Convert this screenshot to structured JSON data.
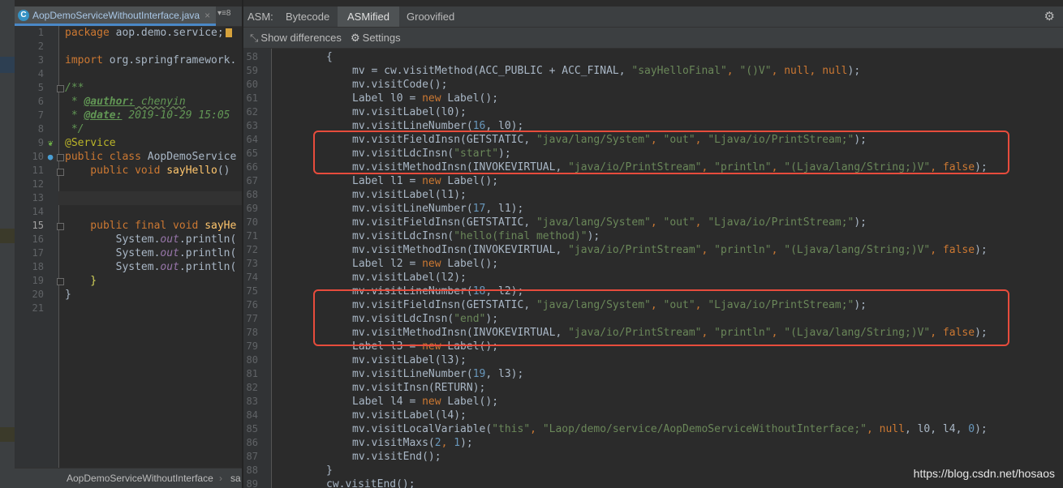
{
  "left_editor": {
    "tab_title": "AopDemoServiceWithoutInterface.java",
    "tab_icon_letter": "C",
    "tab_close": "×",
    "tab_menu": "▾≡8",
    "line_numbers": [
      "1",
      "2",
      "3",
      "4",
      "5",
      "6",
      "7",
      "8",
      "9",
      "10",
      "11",
      "12",
      "13",
      "14",
      "15",
      "16",
      "17",
      "18",
      "19",
      "20",
      "21"
    ],
    "code": {
      "l1a": "package",
      "l1b": " aop.demo.service;",
      "l3a": "import",
      "l3b": " org.springframework.",
      "l5": "/**",
      "l6a": " * ",
      "l6b": "@author:",
      "l6c": " chenyin",
      "l7a": " * ",
      "l7b": "@date:",
      "l7c": " 2019-10-29 15:05",
      "l8": " */",
      "l9": "@Service",
      "l10a": "public class",
      "l10b": " AopDemoService",
      "l11a": "    public void",
      "l11b": " sayHello",
      "l11c": "()",
      "l15a": "    public final void",
      "l15b": " sayHe",
      "l16a": "        System.",
      "l16b": "out",
      "l16c": ".println(",
      "l17a": "        System.",
      "l17b": "out",
      "l17c": ".println(",
      "l18a": "        System.",
      "l18b": "out",
      "l18c": ".println(",
      "l19": "    }",
      "l20": "}"
    },
    "breadcrumb_class": "AopDemoServiceWithoutInterface",
    "breadcrumb_sep": "›",
    "breadcrumb_method": "sa"
  },
  "asm_panel": {
    "label": "ASM:",
    "tabs": [
      "Bytecode",
      "ASMified",
      "Groovified"
    ],
    "selected_tab": "ASMified",
    "show_diff": "Show differences",
    "settings": "Settings",
    "line_numbers": [
      "58",
      "59",
      "60",
      "61",
      "62",
      "63",
      "64",
      "65",
      "66",
      "67",
      "68",
      "69",
      "70",
      "71",
      "72",
      "73",
      "74",
      "75",
      "76",
      "77",
      "78",
      "79",
      "80",
      "81",
      "82",
      "83",
      "84",
      "85",
      "86",
      "87",
      "88",
      "89"
    ],
    "code": {
      "c58": "{",
      "c59a": "mv = cw.visitMethod(ACC_PUBLIC + ACC_FINAL, ",
      "c59b": "\"sayHelloFinal\"",
      "c59c": ", ",
      "c59d": "\"()V\"",
      "c59e": ", ",
      "c59f": "null",
      "c59g": ", ",
      "c59h": "null",
      "c59i": ");",
      "c60": "mv.visitCode();",
      "c61a": "Label l0 = ",
      "c61b": "new",
      "c61c": " Label();",
      "c62": "mv.visitLabel(l0);",
      "c63a": "mv.visitLineNumber(",
      "c63b": "16",
      "c63c": ", l0);",
      "c64a": "mv.visitFieldInsn(GETSTATIC, ",
      "c64b": "\"java/lang/System\"",
      "c64c": ", ",
      "c64d": "\"out\"",
      "c64e": ", ",
      "c64f": "\"Ljava/io/PrintStream;\"",
      "c64g": ");",
      "c65a": "mv.visitLdcInsn(",
      "c65b": "\"start\"",
      "c65c": ");",
      "c66a": "mv.visitMethodInsn(INVOKEVIRTUAL, ",
      "c66b": "\"java/io/PrintStream\"",
      "c66c": ", ",
      "c66d": "\"println\"",
      "c66e": ", ",
      "c66f": "\"(Ljava/lang/String;)V\"",
      "c66g": ", ",
      "c66h": "false",
      "c66i": ");",
      "c67a": "Label l1 = ",
      "c67b": "new",
      "c67c": " Label();",
      "c68": "mv.visitLabel(l1);",
      "c69a": "mv.visitLineNumber(",
      "c69b": "17",
      "c69c": ", l1);",
      "c70a": "mv.visitFieldInsn(GETSTATIC, ",
      "c70b": "\"java/lang/System\"",
      "c70c": ", ",
      "c70d": "\"out\"",
      "c70e": ", ",
      "c70f": "\"Ljava/io/PrintStream;\"",
      "c70g": ");",
      "c71a": "mv.visitLdcInsn(",
      "c71b": "\"hello(final method)\"",
      "c71c": ");",
      "c72a": "mv.visitMethodInsn(INVOKEVIRTUAL, ",
      "c72b": "\"java/io/PrintStream\"",
      "c72c": ", ",
      "c72d": "\"println\"",
      "c72e": ", ",
      "c72f": "\"(Ljava/lang/String;)V\"",
      "c72g": ", ",
      "c72h": "false",
      "c72i": ");",
      "c73a": "Label l2 = ",
      "c73b": "new",
      "c73c": " Label();",
      "c74": "mv.visitLabel(l2);",
      "c75a": "mv.visitLineNumber(",
      "c75b": "18",
      "c75c": ", l2);",
      "c76a": "mv.visitFieldInsn(GETSTATIC, ",
      "c76b": "\"java/lang/System\"",
      "c76c": ", ",
      "c76d": "\"out\"",
      "c76e": ", ",
      "c76f": "\"Ljava/io/PrintStream;\"",
      "c76g": ");",
      "c77a": "mv.visitLdcInsn(",
      "c77b": "\"end\"",
      "c77c": ");",
      "c78a": "mv.visitMethodInsn(INVOKEVIRTUAL, ",
      "c78b": "\"java/io/PrintStream\"",
      "c78c": ", ",
      "c78d": "\"println\"",
      "c78e": ", ",
      "c78f": "\"(Ljava/lang/String;)V\"",
      "c78g": ", ",
      "c78h": "false",
      "c78i": ");",
      "c79a": "Label l3 = ",
      "c79b": "new",
      "c79c": " Label();",
      "c80": "mv.visitLabel(l3);",
      "c81a": "mv.visitLineNumber(",
      "c81b": "19",
      "c81c": ", l3);",
      "c82": "mv.visitInsn(RETURN);",
      "c83a": "Label l4 = ",
      "c83b": "new",
      "c83c": " Label();",
      "c84": "mv.visitLabel(l4);",
      "c85a": "mv.visitLocalVariable(",
      "c85b": "\"this\"",
      "c85c": ", ",
      "c85d": "\"Laop/demo/service/AopDemoServiceWithoutInterface;\"",
      "c85e": ", ",
      "c85f": "null",
      "c85g": ", l0, l4, ",
      "c85h": "0",
      "c85i": ");",
      "c86a": "mv.visitMaxs(",
      "c86b": "2",
      "c86c": ", ",
      "c86d": "1",
      "c86e": ");",
      "c87": "mv.visitEnd();",
      "c88": "}",
      "c89": "cw.visitEnd();"
    }
  },
  "watermark": "https://blog.csdn.net/hosaos",
  "colors": {
    "highlight": "#e74c3c",
    "keyword": "#cc7832",
    "string": "#6a8759",
    "number": "#6897bb"
  }
}
